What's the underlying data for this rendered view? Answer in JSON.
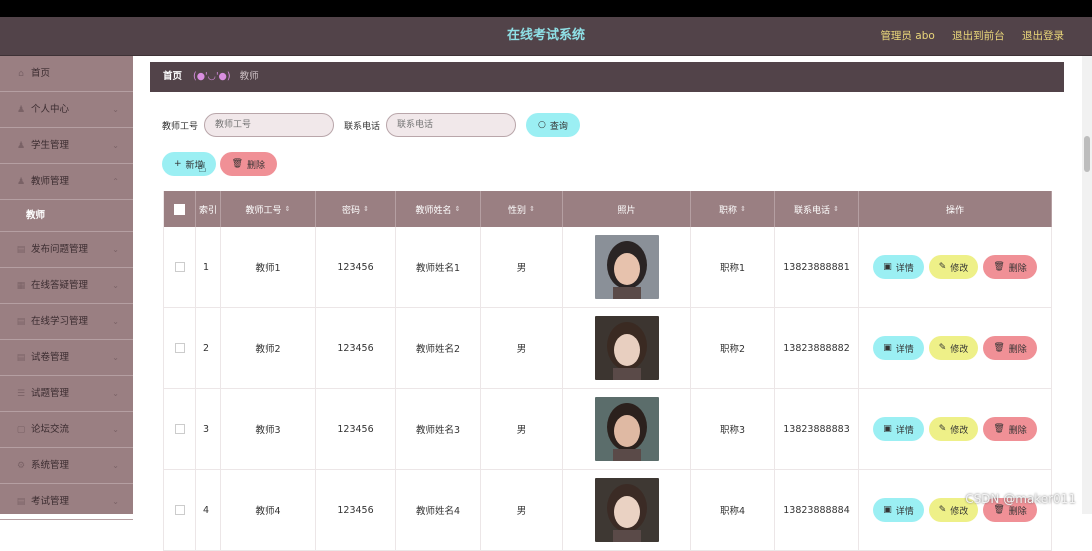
{
  "header": {
    "app_title": "在线考试系统",
    "admin_label": "管理员 abo",
    "back_front": "退出到前台",
    "logout": "退出登录"
  },
  "sidebar": {
    "items": [
      {
        "label": "首页",
        "icon": "home-icon",
        "has_chevron": false
      },
      {
        "label": "个人中心",
        "icon": "user-icon",
        "has_chevron": true
      },
      {
        "label": "学生管理",
        "icon": "user-icon",
        "has_chevron": true
      },
      {
        "label": "教师管理",
        "icon": "user-icon",
        "has_chevron": true,
        "expanded": true,
        "sub": [
          "教师"
        ]
      },
      {
        "label": "发布问题管理",
        "icon": "document-icon",
        "has_chevron": true
      },
      {
        "label": "在线答疑管理",
        "icon": "grid-icon",
        "has_chevron": true
      },
      {
        "label": "在线学习管理",
        "icon": "document-icon",
        "has_chevron": true
      },
      {
        "label": "试卷管理",
        "icon": "document-icon",
        "has_chevron": true
      },
      {
        "label": "试题管理",
        "icon": "list-icon",
        "has_chevron": true
      },
      {
        "label": "论坛交流",
        "icon": "chat-icon",
        "has_chevron": true
      },
      {
        "label": "系统管理",
        "icon": "gear-icon",
        "has_chevron": true
      },
      {
        "label": "考试管理",
        "icon": "document-icon",
        "has_chevron": true
      }
    ]
  },
  "breadcrumb": {
    "home": "首页",
    "face": "(●'◡'●)",
    "current": "教师"
  },
  "search": {
    "teacher_id_label": "教师工号",
    "teacher_id_placeholder": "教师工号",
    "phone_label": "联系电话",
    "phone_placeholder": "联系电话",
    "query_button": "查询"
  },
  "actions": {
    "add_button": "新增",
    "delete_button": "删除"
  },
  "table": {
    "headers": {
      "index": "索引",
      "teacher_id": "教师工号",
      "password": "密码",
      "teacher_name": "教师姓名",
      "gender": "性别",
      "photo": "照片",
      "title": "职称",
      "phone": "联系电话",
      "operation": "操作"
    },
    "row_buttons": {
      "detail": "详情",
      "edit": "修改",
      "delete": "删除"
    },
    "rows": [
      {
        "index": "1",
        "teacher_id": "教师1",
        "password": "123456",
        "teacher_name": "教师姓名1",
        "gender": "男",
        "title": "职称1",
        "phone": "13823888881"
      },
      {
        "index": "2",
        "teacher_id": "教师2",
        "password": "123456",
        "teacher_name": "教师姓名2",
        "gender": "男",
        "title": "职称2",
        "phone": "13823888882"
      },
      {
        "index": "3",
        "teacher_id": "教师3",
        "password": "123456",
        "teacher_name": "教师姓名3",
        "gender": "男",
        "title": "职称3",
        "phone": "13823888883"
      },
      {
        "index": "4",
        "teacher_id": "教师4",
        "password": "123456",
        "teacher_name": "教师姓名4",
        "gender": "男",
        "title": "职称4",
        "phone": "13823888884"
      }
    ]
  },
  "watermark": "CSDN @maker011",
  "colors": {
    "header_bg": "#524349",
    "sidebar_bg": "#9a7f82",
    "title_cyan": "#8fe0e6",
    "accent_yellow": "#e9d67a",
    "btn_cyan": "#9beff3",
    "btn_red": "#f09096",
    "btn_yellow": "#eef088"
  }
}
